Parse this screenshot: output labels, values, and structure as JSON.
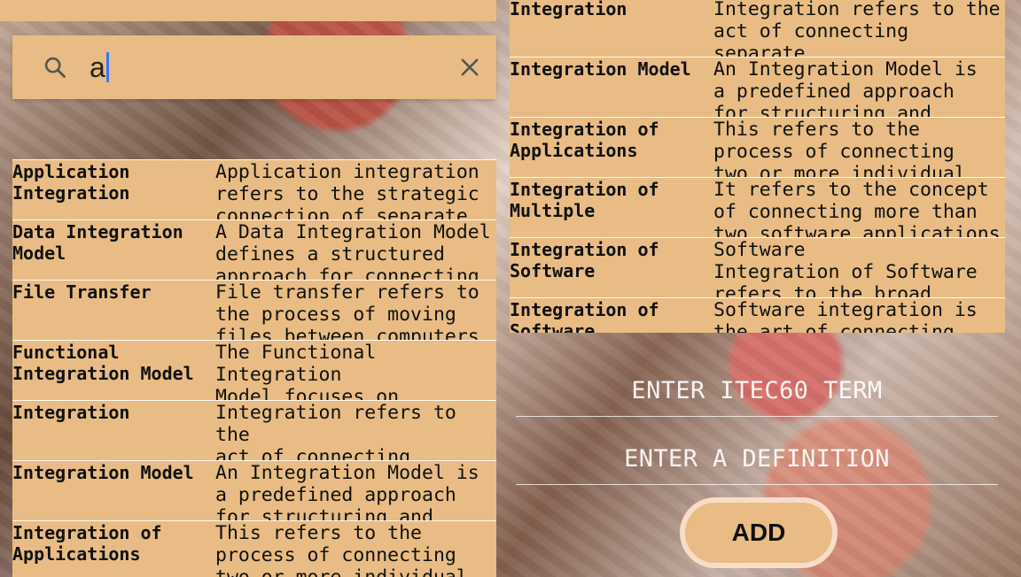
{
  "search": {
    "value": "a"
  },
  "left_list": [
    {
      "term": "Application\nIntegration",
      "definition": "Application integration\nrefers to the strategic\nconnection of separate"
    },
    {
      "term": "Data Integration\nModel",
      "definition": "A Data Integration Model\ndefines a structured\napproach for connecting"
    },
    {
      "term": "File Transfer",
      "definition": "File transfer refers to\nthe process of moving\nfiles between computers"
    },
    {
      "term": "Functional\nIntegration Model",
      "definition": "The Functional Integration\nModel focuses on exposing\nfunctionalities of one"
    },
    {
      "term": "Integration",
      "definition": "Integration refers to the\nact of connecting separate\nsystems to enable them to"
    },
    {
      "term": "Integration Model",
      "definition": "An Integration Model is\na predefined approach\nfor structuring and"
    },
    {
      "term": "Integration of\nApplications",
      "definition": "This refers to the\nprocess of connecting\ntwo or more individual"
    }
  ],
  "right_list": [
    {
      "term": "Integration",
      "definition": "Integration refers to the\nact of connecting separate\nsystems to enable them to"
    },
    {
      "term": "Integration Model",
      "definition": "An Integration Model is\na predefined approach\nfor structuring and"
    },
    {
      "term": "Integration of\nApplications",
      "definition": "This refers to the\nprocess of connecting\ntwo or more individual"
    },
    {
      "term": "Integration of\nMultiple",
      "definition": "It refers to the concept\nof connecting more than\ntwo software applications"
    },
    {
      "term": "Integration of\nSoftware",
      "definition": "Software\nIntegration of Software\nrefers to the broad"
    },
    {
      "term": "Integration of\nSoftware",
      "definition": "Software integration is\nthe art of connecting"
    }
  ],
  "form": {
    "term_placeholder": "ENTER ITEC60 TERM",
    "definition_placeholder": "ENTER A DEFINITION",
    "add_label": "ADD"
  },
  "colors": {
    "row_bg": "#e8bc84",
    "text": "#111111",
    "cursor": "#3476ff",
    "button_border": "#f8dcc8"
  }
}
